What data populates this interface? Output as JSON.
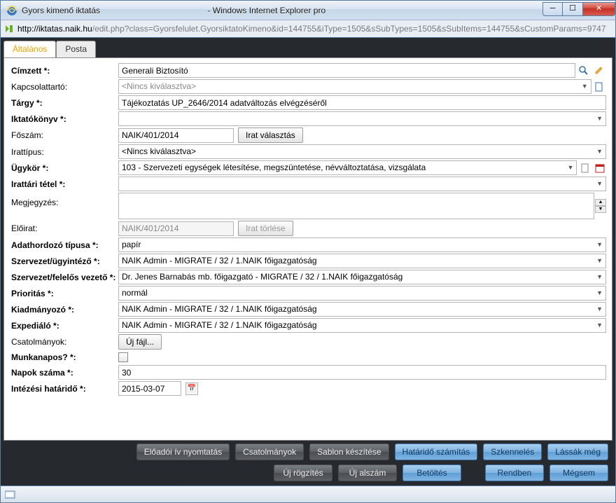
{
  "window": {
    "title_left": "Gyors kimenő iktatás",
    "title_right": "- Windows Internet Explorer pro"
  },
  "address": {
    "host": "http://iktatas.naik.hu",
    "path": "/edit.php?class=Gyorsfelulet.GyorsiktatoKimeno&id=144755&iType=1505&sSubTypes=1505&sSubItems=144755&sCustomParams=9747"
  },
  "tabs": {
    "general": "Általános",
    "post": "Posta"
  },
  "labels": {
    "cimzett": "Címzett *:",
    "kapcsolattarto": "Kapcsolattartó:",
    "targy": "Tárgy *:",
    "iktatokonyv": "Iktatókönyv *:",
    "foszam": "Főszám:",
    "irattipus": "Irattípus:",
    "ugykor": "Ügykör *:",
    "irattari": "Irattári tétel *:",
    "megjegyzes": "Megjegyzés:",
    "eloirat": "Előirat:",
    "adathordozo": "Adathordozó típusa *:",
    "szervezet_ugy": "Szervezet/ügyintéző *:",
    "szervezet_fel": "Szervezet/felelős vezető *:",
    "prioritas": "Prioritás *:",
    "kiadmanyozo": "Kiadmányozó *:",
    "expedialo": "Expediáló *:",
    "csatolmanyok": "Csatolmányok:",
    "munkanapok": "Munkanapos? *:",
    "napokszama": "Napok száma *:",
    "intezesi": "Intézési határidő *:"
  },
  "values": {
    "cimzett": "Generali Biztosító",
    "kapcsolattarto_placeholder": "<Nincs kiválasztva>",
    "targy": "Tájékoztatás UP_2646/2014 adatváltozás elvégzéséről",
    "iktatokonyv": "",
    "foszam": "NAIK/401/2014",
    "irattipus": "<Nincs kiválasztva>",
    "ugykor": "103 - Szervezeti egységek létesítése, megszüntetése, névváltoztatása, vizsgálata",
    "irattari": "",
    "megjegyzes": "",
    "eloirat": "NAIK/401/2014",
    "adathordozo": "papír",
    "szervezet_ugy": "NAIK Admin - MIGRATE / 32 / 1.NAIK főigazgatóság",
    "szervezet_fel": "Dr. Jenes Barnabás mb. főigazgató - MIGRATE / 32 / 1.NAIK főigazgatóság",
    "prioritas": "normál",
    "kiadmanyozo": "NAIK Admin - MIGRATE / 32 / 1.NAIK főigazgatóság",
    "expedialo": "NAIK Admin - MIGRATE / 32 / 1.NAIK főigazgatóság",
    "napokszama": "30",
    "intezesi": "2015-03-07"
  },
  "buttons": {
    "irat_valasztas": "Irat választás",
    "irat_torlese": "Irat törlése",
    "uj_fajl": "Új fájl...",
    "eloadoi": "Előadói ív nyomtatás",
    "csatolmanyok": "Csatolmányok",
    "sablon": "Sablon készítése",
    "hatarido": "Határidő számítás",
    "szkenneles": "Szkennelés",
    "lassak": "Lássák még",
    "uj_rogzites": "Új rögzítés",
    "uj_alszam": "Új alszám",
    "betoltes": "Betöltés",
    "rendben": "Rendben",
    "megsem": "Mégsem"
  }
}
